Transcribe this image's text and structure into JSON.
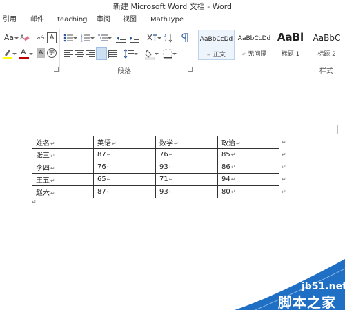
{
  "window": {
    "title": "新建 Microsoft Word 文档 - Word"
  },
  "menu": {
    "tabs": [
      "引用",
      "邮件",
      "teaching",
      "审阅",
      "视图",
      "MathType"
    ]
  },
  "ribbon": {
    "font_size_label": "Aa",
    "phonetic_label": "wén",
    "font_color_label": "A",
    "char_shade_label": "A",
    "enclose_label": "字",
    "paragraph_label": "段落",
    "styles_label": "样式",
    "styles": [
      {
        "sample": "AaBbCcDd",
        "name": "正文"
      },
      {
        "sample": "AaBbCcDd",
        "name": "无间隔"
      },
      {
        "sample": "AaBl",
        "name": "标题 1"
      },
      {
        "sample": "AaBbC",
        "name": "标题 2"
      }
    ],
    "style_para_mark": "↵"
  },
  "document": {
    "table": {
      "headers": [
        "姓名",
        "英语",
        "数学",
        "政治"
      ],
      "rows": [
        [
          "张三",
          "87",
          "76",
          "85"
        ],
        [
          "李四",
          "76",
          "93",
          "86"
        ],
        [
          "王五",
          "65",
          "71",
          "94"
        ],
        [
          "赵六",
          "87",
          "93",
          "80"
        ]
      ]
    },
    "cell_mark": "↵",
    "para_mark": "↵"
  },
  "watermark": {
    "line1": "jb51.net",
    "line2": "脚本之家"
  },
  "colors": {
    "font_color_bar": "#c00000",
    "highlight_bar": "#ffff00",
    "watermark_blue": "#1f6fc5"
  }
}
